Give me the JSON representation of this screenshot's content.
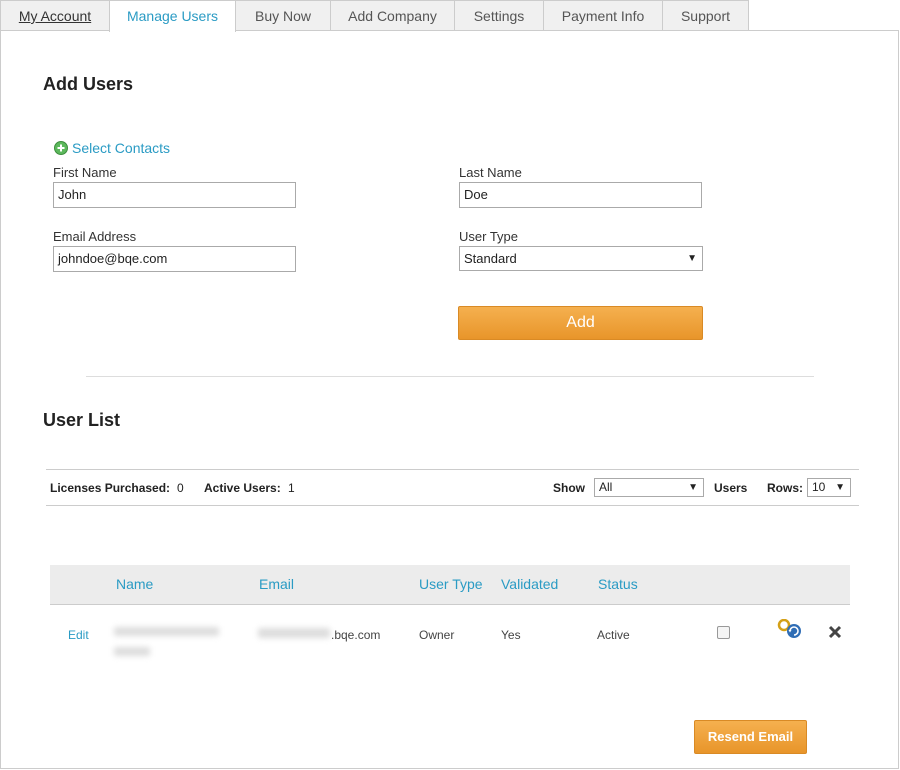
{
  "tabs": [
    "My Account",
    "Manage Users",
    "Buy Now",
    "Add Company",
    "Settings",
    "Payment Info",
    "Support"
  ],
  "add_users": {
    "title": "Add Users",
    "select_contacts": "Select Contacts",
    "first_name_label": "First Name",
    "first_name_value": "John",
    "last_name_label": "Last Name",
    "last_name_value": "Doe",
    "email_label": "Email Address",
    "email_value": "johndoe@bqe.com",
    "user_type_label": "User Type",
    "user_type_value": "Standard",
    "add_button": "Add"
  },
  "user_list": {
    "title": "User List",
    "licenses_label": "Licenses Purchased:",
    "licenses_value": "0",
    "active_label": "Active Users:",
    "active_value": "1",
    "show_label": "Show",
    "show_value": "All",
    "users_label": "Users",
    "rows_label": "Rows:",
    "rows_value": "10",
    "columns": [
      "Name",
      "Email",
      "User Type",
      "Validated",
      "Status"
    ],
    "rows": [
      {
        "edit": "Edit",
        "email_suffix": ".bqe.com",
        "user_type": "Owner",
        "validated": "Yes",
        "status": "Active"
      }
    ],
    "resend_button": "Resend Email"
  },
  "colors": {
    "accent": "#2a9bc4",
    "button": "#f0a13c"
  }
}
